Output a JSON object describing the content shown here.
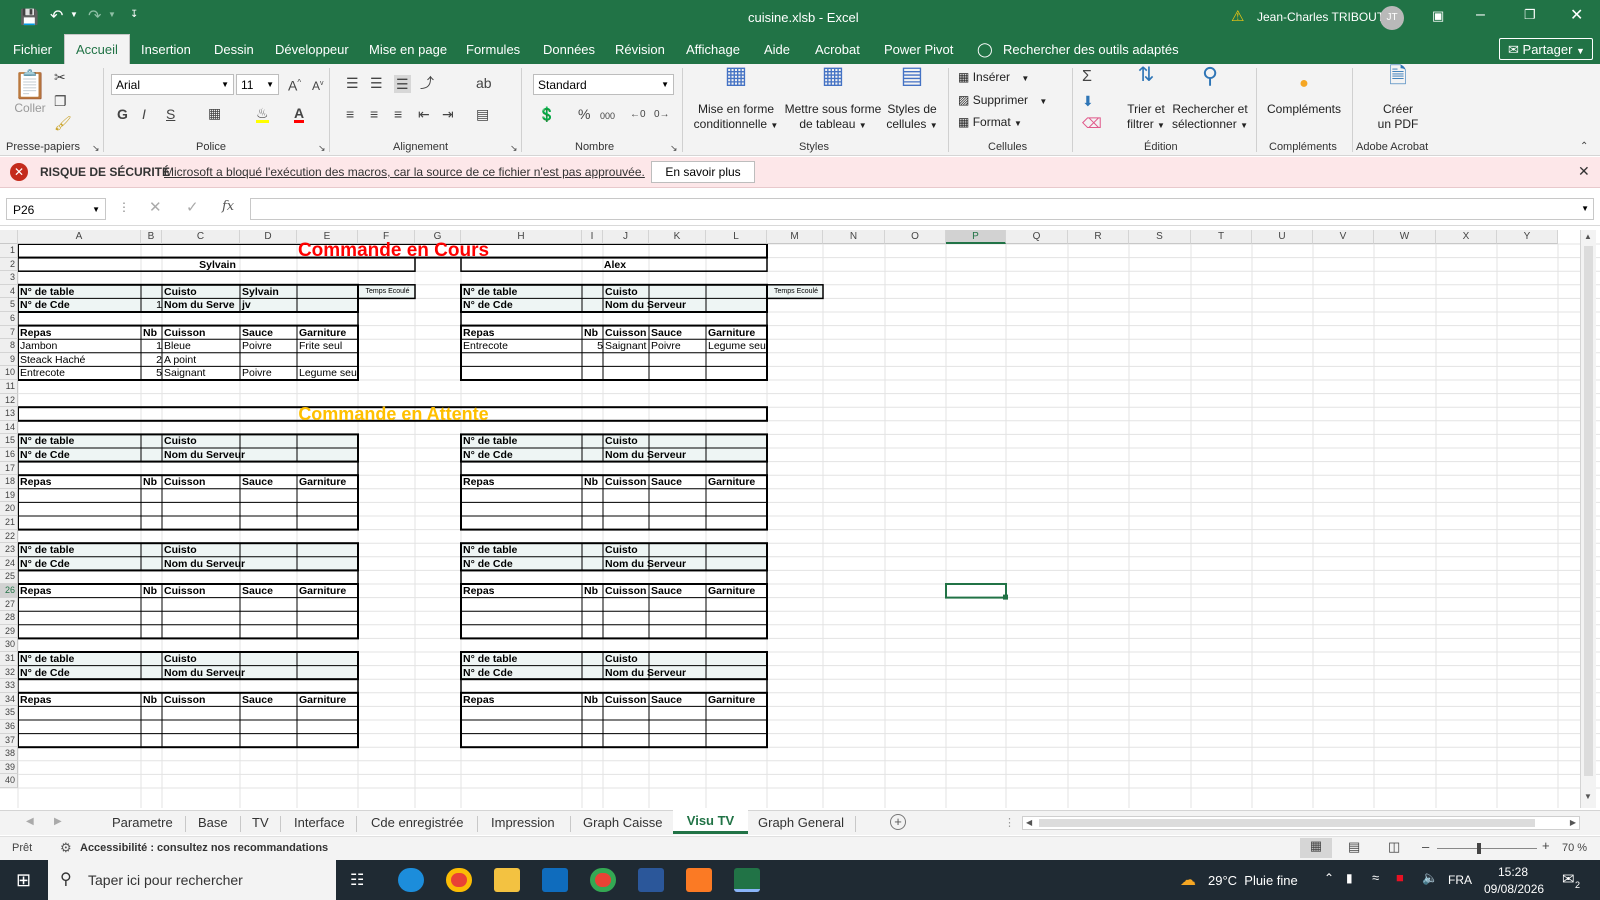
{
  "window": {
    "filename": "cuisine.xlsb",
    "app": "Excel",
    "title_sep": "-",
    "user": "Jean-Charles TRIBOUT",
    "user_initials": "JT"
  },
  "ribbon_tabs": [
    "Fichier",
    "Accueil",
    "Insertion",
    "Dessin",
    "Développeur",
    "Mise en page",
    "Formules",
    "Données",
    "Révision",
    "Affichage",
    "Aide",
    "Acrobat",
    "Power Pivot"
  ],
  "active_tab": "Accueil",
  "search_tools": "Rechercher des outils adaptés",
  "share_label": "Partager",
  "ribbon": {
    "paste_label": "Coller",
    "font_name": "Arial",
    "font_size": "11",
    "number_format": "Standard",
    "cond_format": "Mise en forme",
    "cond_format2": "conditionnelle",
    "table_format": "Mettre sous forme",
    "table_format2": "de tableau",
    "cell_styles": "Styles de",
    "cell_styles2": "cellules",
    "insert": "Insérer",
    "delete": "Supprimer",
    "format": "Format",
    "sort_filter": "Trier et",
    "sort_filter2": "filtrer",
    "find_select": "Rechercher et",
    "find_select2": "sélectionner",
    "addins": "Compléments",
    "create_pdf": "Créer",
    "create_pdf2": "un PDF",
    "groups": [
      "Presse-papiers",
      "Police",
      "Alignement",
      "Nombre",
      "Styles",
      "Cellules",
      "Édition",
      "Compléments",
      "Adobe Acrobat"
    ]
  },
  "security_bar": {
    "title": "RISQUE DE SÉCURITÉ",
    "message": "Microsoft a bloqué l'exécution des macros, car la source de ce fichier n'est pas approuvée.",
    "button": "En savoir plus"
  },
  "formula_bar": {
    "name_box": "P26",
    "fx": "fx",
    "content": ""
  },
  "columns": [
    "A",
    "B",
    "C",
    "D",
    "E",
    "F",
    "G",
    "H",
    "I",
    "J",
    "K",
    "L",
    "M",
    "N",
    "O",
    "P",
    "Q",
    "R",
    "S",
    "T",
    "U",
    "V",
    "W",
    "X",
    "Y"
  ],
  "rows": [
    "1",
    "2",
    "3",
    "4",
    "5",
    "6",
    "7",
    "8",
    "9",
    "10",
    "11",
    "12",
    "13",
    "14",
    "15",
    "16",
    "17",
    "18",
    "19",
    "20",
    "21",
    "22",
    "23",
    "24",
    "25",
    "26",
    "27",
    "28",
    "29",
    "30",
    "31",
    "32",
    "33",
    "34",
    "35",
    "36",
    "37",
    "38",
    "39",
    "40"
  ],
  "sheet": {
    "title_current": "Commande en Cours",
    "title_waiting": "Commande en Attente",
    "chef_left": "Sylvain",
    "chef_right": "Alex",
    "lbl_table": "N° de table",
    "lbl_cde": "N° de Cde",
    "lbl_cuisto": "Cuisto",
    "lbl_serveur": "Nom du Serveur",
    "lbl_serveur_trunc": "Nom du Serve",
    "lbl_repas": "Repas",
    "lbl_nb": "Nb",
    "lbl_cuisson": "Cuisson",
    "lbl_sauce": "Sauce",
    "lbl_garniture": "Garniture",
    "lbl_temps": "Temps Ecoulé",
    "left_order": {
      "cde_num": "1",
      "cuisto": "Sylvain",
      "serveur": "jv",
      "items": [
        {
          "repas": "Jambon",
          "nb": "1",
          "cuisson": "Bleue",
          "sauce": "Poivre",
          "garniture": "Frite seul"
        },
        {
          "repas": "Steack Haché",
          "nb": "2",
          "cuisson": "A point",
          "sauce": "",
          "garniture": ""
        },
        {
          "repas": "Entrecote",
          "nb": "5",
          "cuisson": "Saignant",
          "sauce": "Poivre",
          "garniture": "Legume seul"
        }
      ]
    },
    "right_order": {
      "items": [
        {
          "repas": "Entrecote",
          "nb": "5",
          "cuisson": "Saignant",
          "sauce": "Poivre",
          "garniture": "Legume seul"
        }
      ]
    }
  },
  "sheet_tabs": [
    "Parametre",
    "Base",
    "TV",
    "Interface",
    "Cde enregistrée",
    "Impression",
    "Graph Caisse",
    "Visu TV",
    "Graph General"
  ],
  "active_sheet": "Visu TV",
  "status": {
    "ready": "Prêt",
    "accessibility": "Accessibilité : consultez nos recommandations",
    "zoom": "70 %"
  },
  "taskbar": {
    "search": "Taper ici pour rechercher",
    "weather": "29°C  Pluie fine",
    "lang": "FRA",
    "time": "15:28",
    "date": "09/08/2026",
    "notif_count": "2"
  },
  "colors": {
    "excel_green": "#217346",
    "title_red": "#ff0000",
    "title_orange": "#ffc000",
    "security_pink": "#fde7e9"
  }
}
